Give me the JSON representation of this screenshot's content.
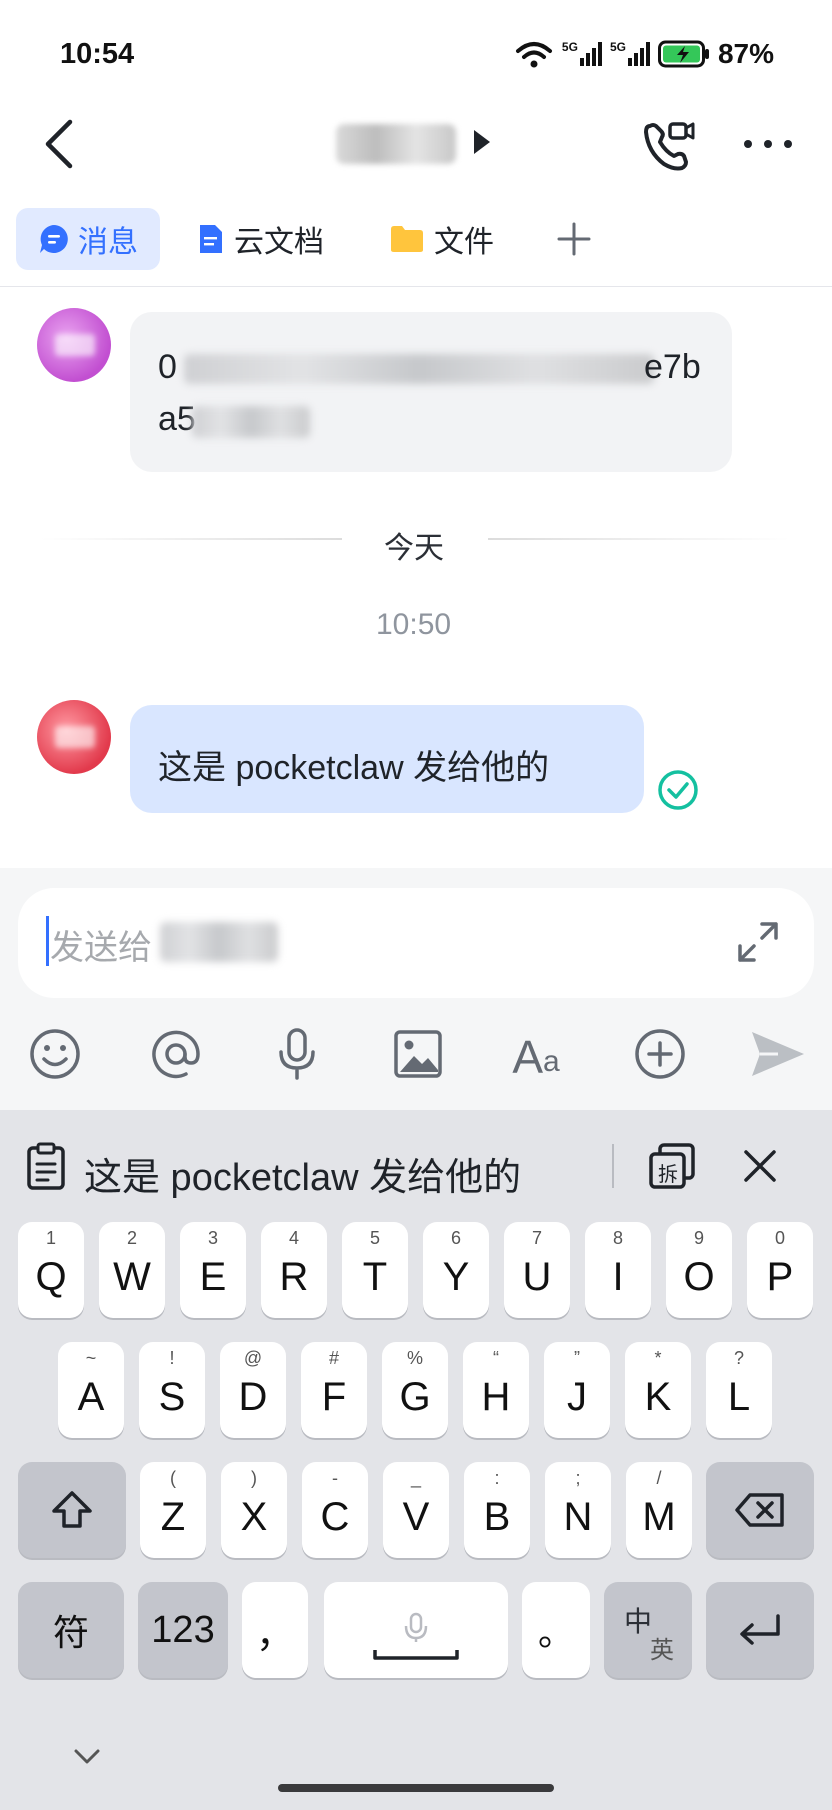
{
  "status": {
    "time": "10:54",
    "battery": "87%",
    "net1": "5G",
    "net2": "5G"
  },
  "tabs": [
    {
      "label": "消息"
    },
    {
      "label": "云文档"
    },
    {
      "label": "文件"
    }
  ],
  "messages": {
    "first": {
      "line1_start": "0",
      "line1_end": "e7b",
      "line2_start": "a5"
    },
    "divider": "今天",
    "timestamp": "10:50",
    "second": {
      "text": "这是 pocketclaw 发给他的"
    }
  },
  "input": {
    "placeholder": "发送给"
  },
  "clipboard": {
    "text": "这是 pocketclaw 发给他的",
    "split_label": "拆"
  },
  "keyboard": {
    "row1": [
      {
        "sup": "1",
        "key": "Q"
      },
      {
        "sup": "2",
        "key": "W"
      },
      {
        "sup": "3",
        "key": "E"
      },
      {
        "sup": "4",
        "key": "R"
      },
      {
        "sup": "5",
        "key": "T"
      },
      {
        "sup": "6",
        "key": "Y"
      },
      {
        "sup": "7",
        "key": "U"
      },
      {
        "sup": "8",
        "key": "I"
      },
      {
        "sup": "9",
        "key": "O"
      },
      {
        "sup": "0",
        "key": "P"
      }
    ],
    "row2": [
      {
        "sup": "~",
        "key": "A"
      },
      {
        "sup": "!",
        "key": "S"
      },
      {
        "sup": "@",
        "key": "D"
      },
      {
        "sup": "#",
        "key": "F"
      },
      {
        "sup": "%",
        "key": "G"
      },
      {
        "sup": "“",
        "key": "H"
      },
      {
        "sup": "”",
        "key": "J"
      },
      {
        "sup": "*",
        "key": "K"
      },
      {
        "sup": "?",
        "key": "L"
      }
    ],
    "row3": [
      {
        "sup": "(",
        "key": "Z"
      },
      {
        "sup": ")",
        "key": "X"
      },
      {
        "sup": "-",
        "key": "C"
      },
      {
        "sup": "_",
        "key": "V"
      },
      {
        "sup": ":",
        "key": "B"
      },
      {
        "sup": ";",
        "key": "N"
      },
      {
        "sup": "/",
        "key": "M"
      }
    ],
    "symbol_label": "符",
    "num_label": "123",
    "comma_label": "，",
    "period_label": "。",
    "lang_top": "中",
    "lang_bottom": "英"
  }
}
